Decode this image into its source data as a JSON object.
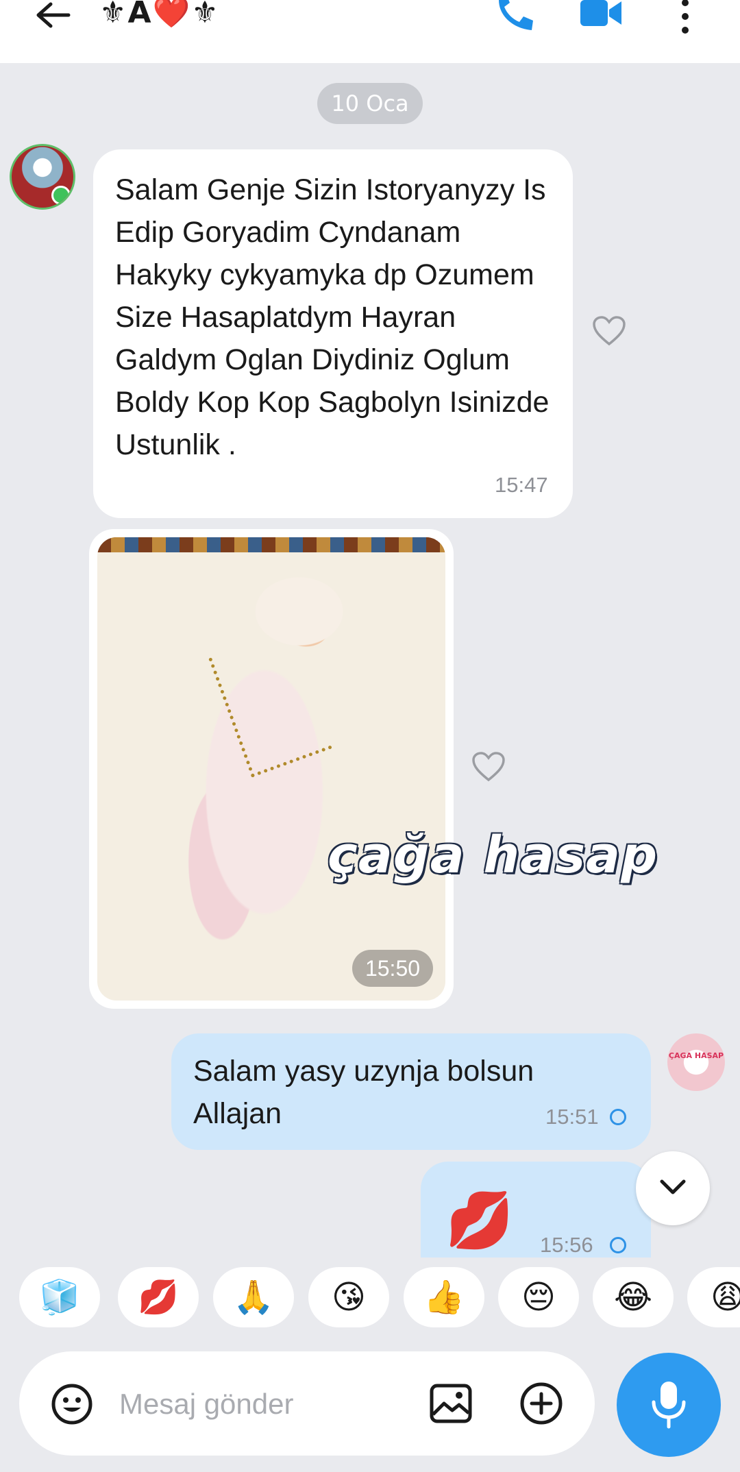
{
  "header": {
    "title": "⚜A❤️⚜",
    "icons": {
      "back": "arrow-left-icon",
      "call": "phone-icon",
      "video": "video-camera-icon",
      "menu": "more-vertical-icon"
    },
    "accent_color": "#1e8fe8"
  },
  "date_chip": "10 Oca",
  "messages": [
    {
      "direction": "incoming",
      "text": "Salam Genje Sizin Istoryanyzy Is Edip Goryadim Cyndanam Hakyky cykyamyka dp Ozumem Size  Hasaplatdym Hayran Galdym Oglan Diydiniz Oglum Boldy Kop Kop Sagbolyn Isinizde Ustunlik .",
      "time": "15:47"
    },
    {
      "direction": "incoming",
      "type": "photo",
      "time": "15:50"
    },
    {
      "direction": "outgoing",
      "text": "Salam yasy uzynja bolsun Allajan",
      "time": "15:51"
    },
    {
      "direction": "outgoing",
      "emoji": "💋",
      "time": "15:56"
    }
  ],
  "avatar_right_text": "ÇAGA HASAP",
  "watermark": "çağa hasap",
  "reactions": [
    "🧊",
    "💋",
    "🙏",
    "😘",
    "👍",
    "😔",
    "😂",
    "😩"
  ],
  "composer": {
    "placeholder": "Mesaj gönder"
  },
  "colors": {
    "bubble_out": "#cfe7fb",
    "bubble_in": "#ffffff",
    "background": "#e9eaee",
    "mic": "#2e9bf0"
  }
}
